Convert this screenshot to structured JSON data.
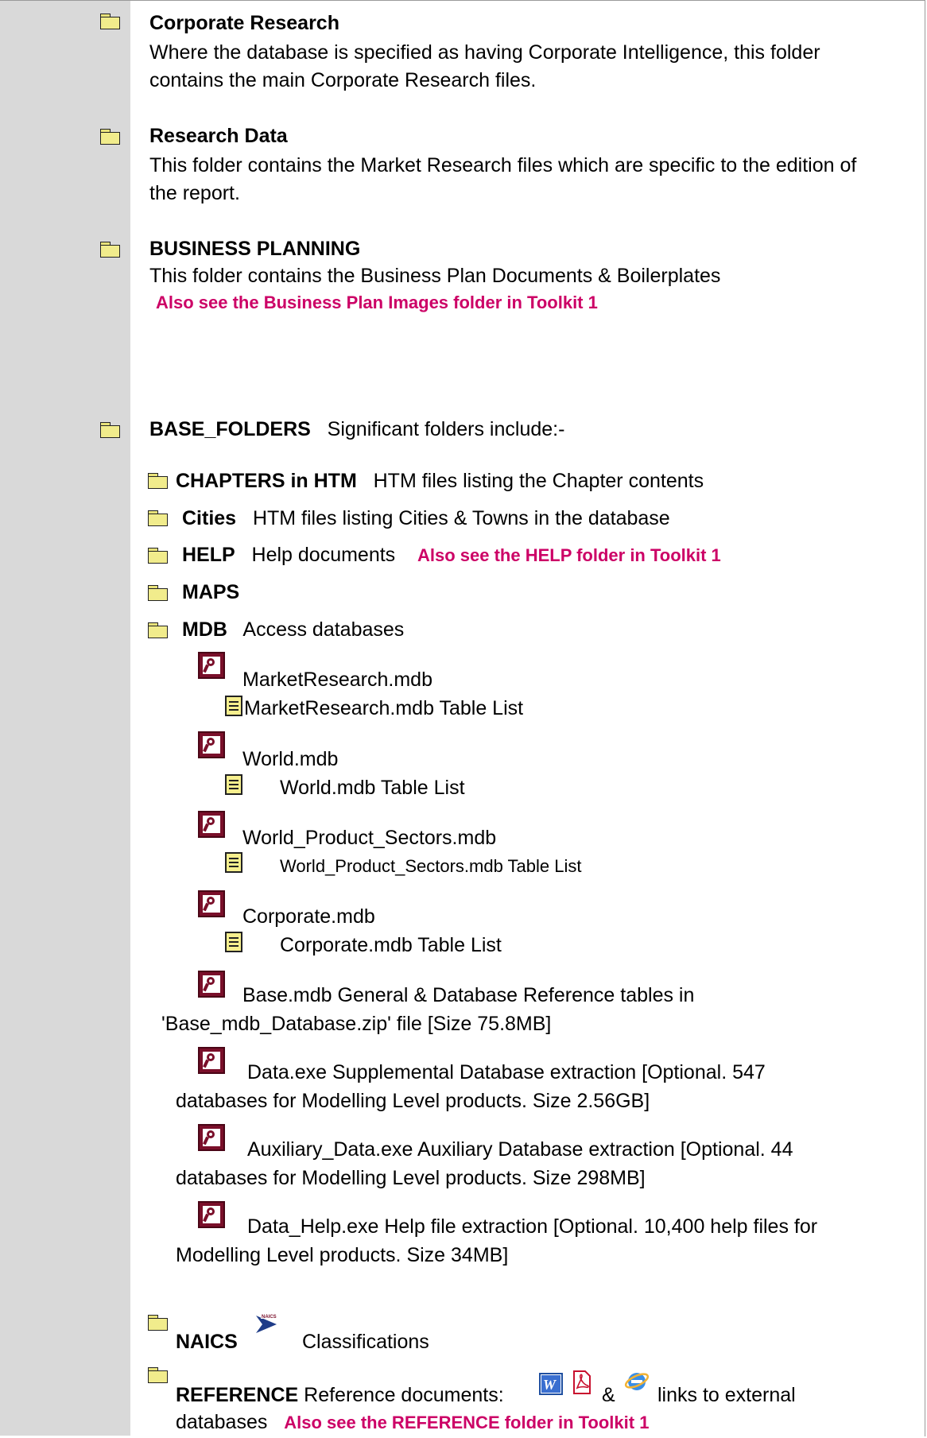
{
  "sections": {
    "corporate_research": {
      "title": "Corporate Research",
      "desc_line1": "Where the database is specified as having Corporate Intelligence, this folder",
      "desc_line2": "contains the main Corporate Research files."
    },
    "research_data": {
      "title": "Research Data",
      "desc_line1": "This folder contains the Market Research files which are specific to the edition of",
      "desc_line2": "the report."
    },
    "business_planning": {
      "title": "BUSINESS PLANNING",
      "desc": "This folder contains the Business Plan Documents & Boilerplates",
      "note": "Also see the Business Plan Images folder in Toolkit 1"
    },
    "base_folders": {
      "title": "BASE_FOLDERS",
      "desc": "Significant folders include:-"
    }
  },
  "subfolders": {
    "chapters": {
      "name": "CHAPTERS in HTM",
      "desc": "HTM files listing the Chapter contents"
    },
    "cities": {
      "name": "Cities",
      "desc": "HTM files listing Cities & Towns in the database"
    },
    "help": {
      "name": "HELP",
      "desc": "Help documents",
      "note": "Also see the HELP folder in Toolkit 1"
    },
    "maps": {
      "name": "MAPS"
    },
    "mdb": {
      "name": "MDB",
      "desc": "Access databases"
    },
    "naics": {
      "name": "NAICS",
      "desc": "Classifications"
    },
    "reference": {
      "name": "REFERENCE",
      "desc_a": "Reference documents:",
      "amp": "&",
      "desc_b": "links to external",
      "desc_c": "databases",
      "note": "Also see the REFERENCE folder in Toolkit 1"
    }
  },
  "databases": {
    "market": {
      "file": "MarketResearch.mdb",
      "table_list": "MarketResearch.mdb Table List"
    },
    "world": {
      "file": "World.mdb",
      "table_list": "World.mdb Table List"
    },
    "world_sectors": {
      "file": "World_Product_Sectors.mdb",
      "table_list": "World_Product_Sectors.mdb Table List"
    },
    "corporate": {
      "file": "Corporate.mdb",
      "table_list": "Corporate.mdb Table List"
    },
    "base": {
      "line1": "Base.mdb   General & Database Reference tables in",
      "line2": "'Base_mdb_Database.zip' file [Size 75.8MB]"
    },
    "data": {
      "line1": "Data.exe   Supplemental Database extraction [Optional. 547",
      "line2": "databases for Modelling Level products. Size 2.56GB]"
    },
    "aux": {
      "line1": "Auxiliary_Data.exe   Auxiliary Database extraction [Optional. 44",
      "line2": "databases for Modelling Level products. Size 298MB]"
    },
    "help": {
      "line1": "Data_Help.exe   Help file extraction [Optional. 10,400 help files for",
      "line2": "Modelling Level products. Size 34MB]"
    }
  },
  "icons": {
    "folder": "folder-icon",
    "access": "access-db-icon",
    "document": "document-icon",
    "naics": "naics-logo-icon",
    "word": "word-icon",
    "pdf": "pdf-icon",
    "ie": "internet-explorer-icon"
  },
  "colors": {
    "note": "#cc0066",
    "sidebar": "#d9d9d9"
  }
}
